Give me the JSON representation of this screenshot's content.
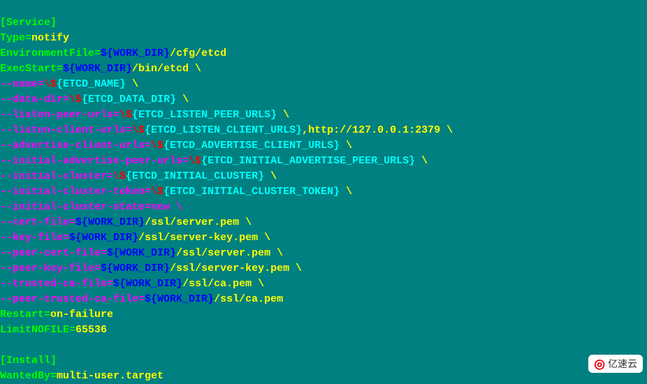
{
  "service_header": "[Service]",
  "type_key": "Type=",
  "type_val": "notify",
  "envfile_key": "EnvironmentFile=",
  "workdir": "${WORK_DIR}",
  "envfile_suffix": "/cfg/etcd",
  "execstart_key": "ExecStart=",
  "execstart_suffix": "/bin/etcd \\",
  "name_flag": "--name=",
  "name_escape": "\\$",
  "name_var": "{ETCD_NAME}",
  "bs_b": " \\",
  "datadir_flag": "--data-dir=",
  "datadir_escape": "\\$",
  "datadir_var": "{ETCD_DATA_DIR}",
  "lpu_flag": "--listen-peer-urls=",
  "lpu_escape": "\\$",
  "lpu_var": "{ETCD_LISTEN_PEER_URLS}",
  "lcu_flag": "--listen-client-urls=",
  "lcu_escape": "\\$",
  "lcu_var": "{ETCD_LISTEN_CLIENT_URLS}",
  "lcu_extra": ",http://127.0.0.1:2379 \\",
  "acu_flag": "--advertise-client-urls=",
  "acu_escape": "\\$",
  "acu_var": "{ETCD_ADVERTISE_CLIENT_URLS}",
  "iapu_flag": "--initial-advertise-peer-urls=",
  "iapu_escape": "\\$",
  "iapu_var": "{ETCD_INITIAL_ADVERTISE_PEER_URLS}",
  "ic_flag": "--initial-cluster=",
  "ic_escape": "\\$",
  "ic_var": "{ETCD_INITIAL_CLUSTER}",
  "ict_flag": "--initial-cluster-token=",
  "ict_escape": "\\$",
  "ict_var": "{ETCD_INITIAL_CLUSTER_TOKEN}",
  "ics_line": "--initial-cluster-state=new \\",
  "certfile_flag": "--cert-file=",
  "certfile_suffix": "/ssl/server.pem \\",
  "keyfile_flag": "--key-file=",
  "keyfile_suffix": "/ssl/server-key.pem \\",
  "pcertfile_flag": "--peer-cert-file=",
  "pcertfile_suffix": "/ssl/server.pem \\",
  "pkeyfile_flag": "--peer-key-file=",
  "pkeyfile_suffix": "/ssl/server-key.pem \\",
  "tcafile_flag": "--trusted-ca-file=",
  "tcafile_suffix": "/ssl/ca.pem \\",
  "ptcafile_flag": "--peer-trusted-ca-file=",
  "ptcafile_suffix": "/ssl/ca.pem",
  "restart_key": "Restart=",
  "restart_val": "on-failure",
  "limit_key": "LimitNOFILE=",
  "limit_val": "65536",
  "install_header": "[Install]",
  "wantedby_key": "WantedBy=",
  "wantedby_val": "multi-user.target",
  "watermark_text": "亿速云"
}
